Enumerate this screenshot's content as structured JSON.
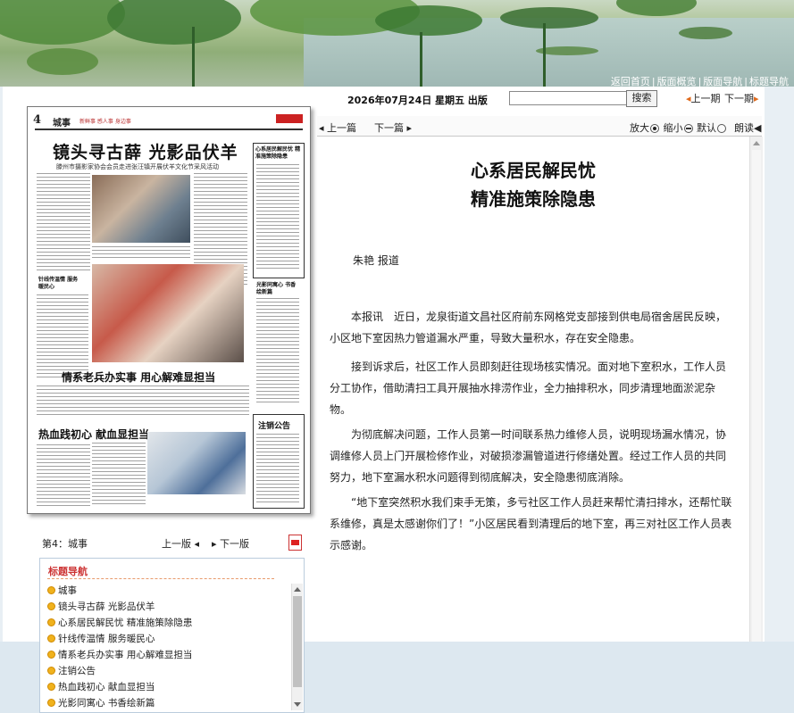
{
  "top_nav": [
    "返回首页",
    "版面概览",
    "版面导航",
    "标题导航"
  ],
  "paper_thumb": {
    "page_no": "4",
    "section": "城事",
    "slogan": "新鲜事 感人事 身边事",
    "headline": "镜头寻古薛 光影品伏羊",
    "subheadline": "滕州市摄影家协会会员走进张汪镇开展伏羊文化节采风活动",
    "story2": "情系老兵办实事 用心解难显担当",
    "story3": "热血践初心 献血显担当",
    "box_title": "注销公告",
    "side1": "心系居民解民忧 精准施策除隐患",
    "side2": "针线传温情 服务暖民心",
    "side3": "光影同寓心 书香绘新篇"
  },
  "page_bar": {
    "name": "第4：城事",
    "prev": "上一版",
    "next": "下一版"
  },
  "headline_nav": {
    "title": "标题导航",
    "items": [
      "城事",
      "镜头寻古薛 光影品伏羊",
      "心系居民解民忧 精准施策除隐患",
      "针线传温情 服务暖民心",
      "情系老兵办实事 用心解难显担当",
      "注销公告",
      "热血践初心 献血显担当",
      "光影同寓心 书香绘新篇"
    ]
  },
  "header": {
    "date_line": "2026年07月24日 星期五 出版",
    "search_placeholder": "",
    "search_button": "搜索",
    "prev_issue": "上一期",
    "next_issue": "下一期"
  },
  "toolbar": {
    "prev_article": "上一篇",
    "next_article": "下一篇",
    "enlarge": "放大",
    "shrink": "缩小",
    "default": "默认",
    "read_aloud": "朗读"
  },
  "article": {
    "title_line1": "心系居民解民忧",
    "title_line2": "精准施策除隐患",
    "author": "朱艳 报道",
    "paragraphs": [
      "本报讯　近日，龙泉街道文昌社区府前东网格党支部接到供电局宿舍居民反映，小区地下室因热力管道漏水严重，导致大量积水，存在安全隐患。",
      "接到诉求后，社区工作人员即刻赶往现场核实情况。面对地下室积水，工作人员分工协作，借助清扫工具开展抽水排涝作业，全力抽排积水，同步清理地面淤泥杂物。",
      "为彻底解决问题，工作人员第一时间联系热力维修人员，说明现场漏水情况，协调维修人员上门开展检修作业，对破损渗漏管道进行修缮处置。经过工作人员的共同努力，地下室漏水积水问题得到彻底解决，安全隐患彻底消除。",
      "“地下室突然积水我们束手无策，多亏社区工作人员赶来帮忙清扫排水，还帮忙联系维修，真是太感谢你们了！”小区居民看到清理后的地下室，再三对社区工作人员表示感谢。"
    ]
  }
}
